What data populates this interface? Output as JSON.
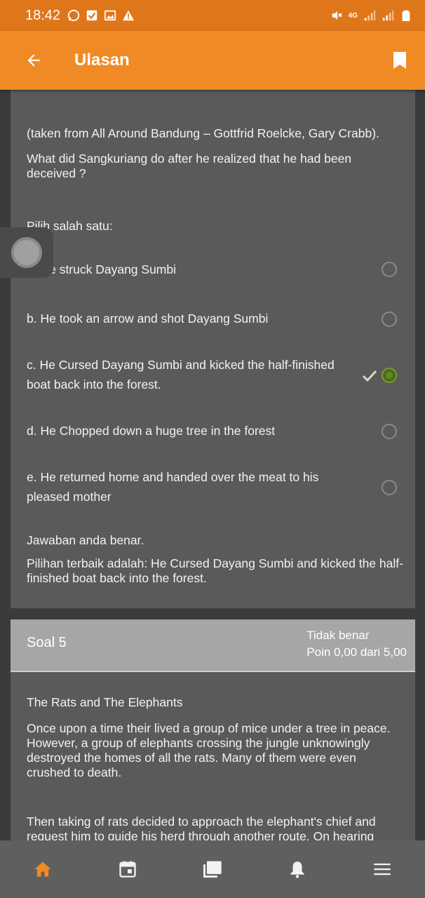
{
  "status_bar": {
    "time": "18:42",
    "left_icons": [
      "whatsapp-icon",
      "check-box-icon",
      "gallery-icon",
      "warning-icon"
    ],
    "right_icons": [
      "mute-icon",
      "4g-icon",
      "signal-icon",
      "signal-icon",
      "battery-icon"
    ],
    "network": "4G"
  },
  "app_bar": {
    "title": "Ulasan",
    "back_icon": "arrow-left-icon",
    "bookmark_icon": "bookmark-icon"
  },
  "colors": {
    "accent": "#f08a24",
    "status_bar": "#e0761a",
    "card": "#5a5a5a",
    "background": "#3b3b3b",
    "correct": "#5e8a24"
  },
  "question4": {
    "source": "(taken from All Around Bandung – Gottfrid Roelcke, Gary Crabb).",
    "question": "What did Sangkuriang do after he realized that he had been deceived ?",
    "prompt": "Pilih salah satu:",
    "options": [
      {
        "label": "a. He struck Dayang Sumbi",
        "selected": false
      },
      {
        "label": "b. He took an arrow and shot Dayang Sumbi",
        "selected": false
      },
      {
        "label": "c. He Cursed Dayang Sumbi and kicked the half-finished boat back into the forest.",
        "selected": true,
        "correct": true
      },
      {
        "label": "d.  He Chopped down a huge tree in the forest",
        "selected": false
      },
      {
        "label": "e. He returned home and handed over the meat to his pleased mother",
        "selected": false
      }
    ],
    "feedback": "Jawaban anda benar.",
    "best_answer": "Pilihan terbaik adalah: He Cursed Dayang Sumbi and kicked the half-finished boat back into the forest."
  },
  "question5": {
    "label": "Soal 5",
    "status": "Tidak benar",
    "points": "Poin 0,00 dari 5,00",
    "title": "The Rats and The Elephants",
    "paragraph1": "Once upon a time their lived a group of mice under a tree in peace. However, a group of elephants crossing the jungle unknowingly destroyed the homes of all the rats. Many of them were even crushed to death.",
    "paragraph2": "Then taking of rats decided to approach the elephant's chief and request him to guide his herd through another route. On hearing"
  },
  "bottom_nav": {
    "items": [
      {
        "icon": "home-icon",
        "active": true
      },
      {
        "icon": "calendar-icon",
        "active": false
      },
      {
        "icon": "courses-icon",
        "active": false
      },
      {
        "icon": "bell-icon",
        "active": false
      },
      {
        "icon": "menu-icon",
        "active": false
      }
    ]
  }
}
